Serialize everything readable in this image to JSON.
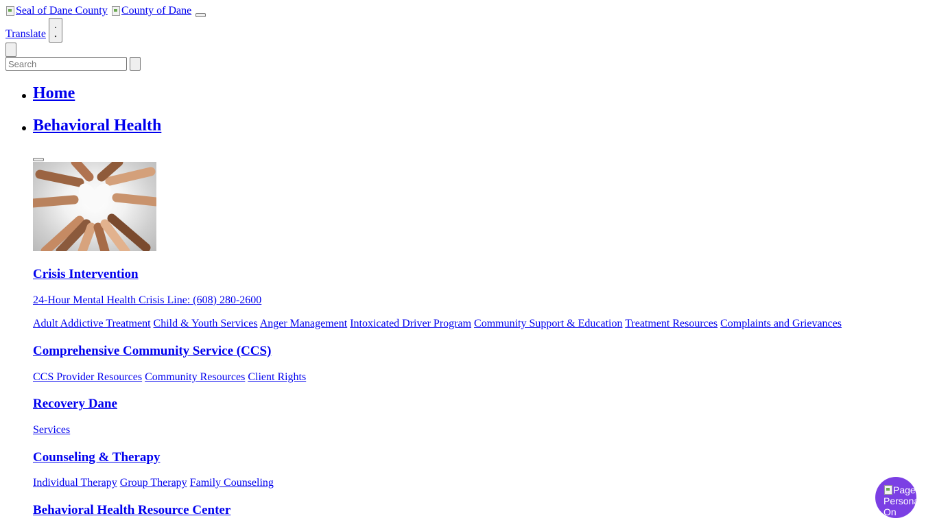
{
  "header": {
    "seal_alt": "Seal of Dane County",
    "county_alt": "County of Dane",
    "translate_label": "Translate",
    "search": {
      "placeholder": "Search"
    }
  },
  "nav": {
    "items": [
      {
        "label": "Home"
      },
      {
        "label": "Behavioral Health"
      }
    ]
  },
  "content": {
    "sections": [
      {
        "title": "Crisis Intervention",
        "sublink": "24-Hour Mental Health Crisis Line: (608) 280-2600",
        "links": [
          "Adult Addictive Treatment",
          "Child & Youth Services",
          "Anger Management",
          "Intoxicated Driver Program",
          "Community Support & Education",
          "Treatment Resources",
          "Complaints and Grievances"
        ]
      },
      {
        "title": "Comprehensive Community Service (CCS)",
        "links": [
          "CCS Provider Resources",
          "Community Resources",
          "Client Rights"
        ]
      },
      {
        "title": "Recovery Dane",
        "links": [
          "Services"
        ]
      },
      {
        "title": "Counseling & Therapy",
        "links": [
          "Individual Therapy",
          "Group Therapy",
          "Family Counseling"
        ]
      },
      {
        "title": "Behavioral Health Resource Center",
        "links": []
      }
    ]
  },
  "persona_widget": {
    "text": "Page Personalization On"
  },
  "colors": {
    "link": "#0000ee",
    "persona_bg": "#7b3fe4"
  }
}
